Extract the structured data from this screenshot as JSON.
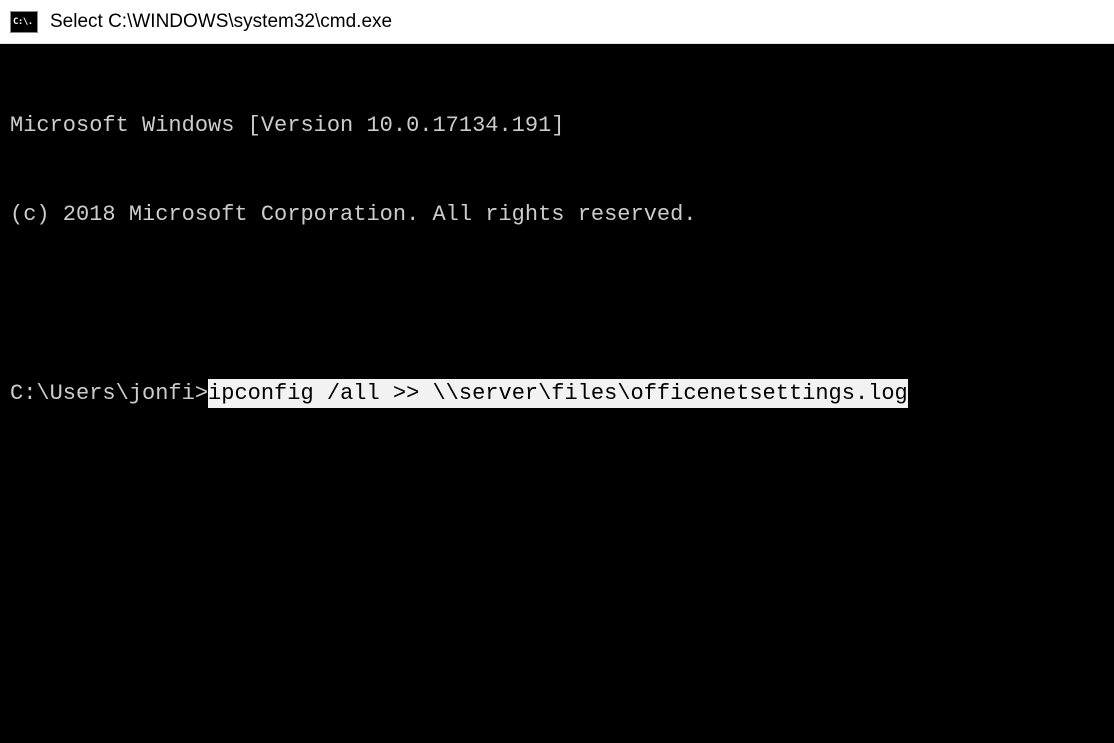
{
  "titlebar": {
    "icon_label": "C:\\.",
    "title": "Select C:\\WINDOWS\\system32\\cmd.exe"
  },
  "terminal": {
    "line1": "Microsoft Windows [Version 10.0.17134.191]",
    "line2": "(c) 2018 Microsoft Corporation. All rights reserved.",
    "prompt": "C:\\Users\\jonfi>",
    "command": "ipconfig /all >> \\\\server\\files\\officenetsettings.log"
  }
}
